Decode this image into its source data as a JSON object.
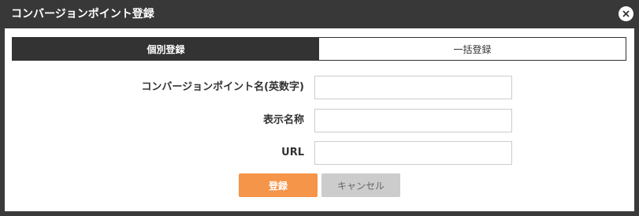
{
  "dialog": {
    "title": "コンバージョンポイント登録",
    "close_icon": "close-icon"
  },
  "tabs": [
    {
      "label": "個別登録",
      "active": true
    },
    {
      "label": "一括登録",
      "active": false
    }
  ],
  "form": {
    "name_label": "コンバージョンポイント名(英数字)",
    "name_value": "",
    "display_label": "表示名称",
    "display_value": "",
    "url_label": "URL",
    "url_value": ""
  },
  "buttons": {
    "register_label": "登録",
    "cancel_label": "キャンセル"
  },
  "colors": {
    "titlebar": "#383838",
    "active_tab": "#333333",
    "register_button": "#f5954a",
    "cancel_button": "#cccccc"
  }
}
